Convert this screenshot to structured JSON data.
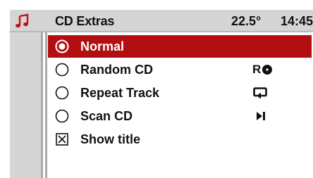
{
  "header": {
    "title": "CD Extras",
    "temperature": "22.5°",
    "time": "14:45",
    "icon": "music-note-icon",
    "icon_color": "#c1121a"
  },
  "menu": {
    "items": [
      {
        "label": "Normal",
        "control": "radio",
        "checked": true,
        "selected": true,
        "status_icon": ""
      },
      {
        "label": "Random CD",
        "control": "radio",
        "checked": false,
        "selected": false,
        "status_icon": "random-cd-icon",
        "status_text": "R"
      },
      {
        "label": "Repeat Track",
        "control": "radio",
        "checked": false,
        "selected": false,
        "status_icon": "repeat-icon"
      },
      {
        "label": "Scan CD",
        "control": "radio",
        "checked": false,
        "selected": false,
        "status_icon": "scan-icon"
      },
      {
        "label": "Show title",
        "control": "checkbox",
        "checked": true,
        "selected": false,
        "status_icon": ""
      }
    ]
  },
  "colors": {
    "selection": "#b30e12",
    "panel": "#d5d5d5",
    "text": "#111111",
    "background": "#ffffff"
  }
}
